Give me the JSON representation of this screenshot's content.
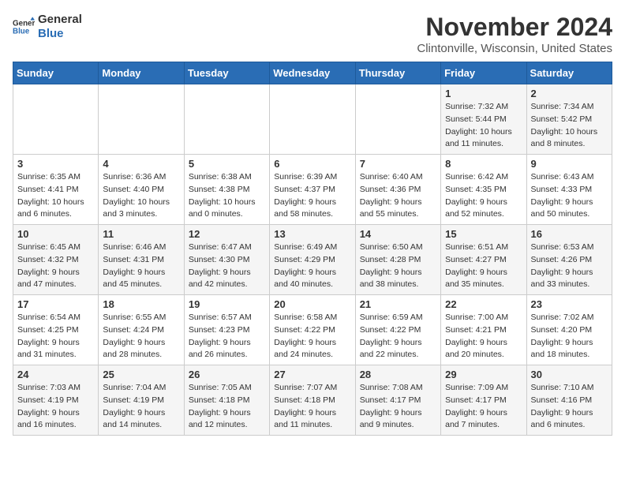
{
  "header": {
    "logo_line1": "General",
    "logo_line2": "Blue",
    "month_title": "November 2024",
    "subtitle": "Clintonville, Wisconsin, United States"
  },
  "days_of_week": [
    "Sunday",
    "Monday",
    "Tuesday",
    "Wednesday",
    "Thursday",
    "Friday",
    "Saturday"
  ],
  "weeks": [
    [
      {
        "day": "",
        "info": ""
      },
      {
        "day": "",
        "info": ""
      },
      {
        "day": "",
        "info": ""
      },
      {
        "day": "",
        "info": ""
      },
      {
        "day": "",
        "info": ""
      },
      {
        "day": "1",
        "info": "Sunrise: 7:32 AM\nSunset: 5:44 PM\nDaylight: 10 hours and 11 minutes."
      },
      {
        "day": "2",
        "info": "Sunrise: 7:34 AM\nSunset: 5:42 PM\nDaylight: 10 hours and 8 minutes."
      }
    ],
    [
      {
        "day": "3",
        "info": "Sunrise: 6:35 AM\nSunset: 4:41 PM\nDaylight: 10 hours and 6 minutes."
      },
      {
        "day": "4",
        "info": "Sunrise: 6:36 AM\nSunset: 4:40 PM\nDaylight: 10 hours and 3 minutes."
      },
      {
        "day": "5",
        "info": "Sunrise: 6:38 AM\nSunset: 4:38 PM\nDaylight: 10 hours and 0 minutes."
      },
      {
        "day": "6",
        "info": "Sunrise: 6:39 AM\nSunset: 4:37 PM\nDaylight: 9 hours and 58 minutes."
      },
      {
        "day": "7",
        "info": "Sunrise: 6:40 AM\nSunset: 4:36 PM\nDaylight: 9 hours and 55 minutes."
      },
      {
        "day": "8",
        "info": "Sunrise: 6:42 AM\nSunset: 4:35 PM\nDaylight: 9 hours and 52 minutes."
      },
      {
        "day": "9",
        "info": "Sunrise: 6:43 AM\nSunset: 4:33 PM\nDaylight: 9 hours and 50 minutes."
      }
    ],
    [
      {
        "day": "10",
        "info": "Sunrise: 6:45 AM\nSunset: 4:32 PM\nDaylight: 9 hours and 47 minutes."
      },
      {
        "day": "11",
        "info": "Sunrise: 6:46 AM\nSunset: 4:31 PM\nDaylight: 9 hours and 45 minutes."
      },
      {
        "day": "12",
        "info": "Sunrise: 6:47 AM\nSunset: 4:30 PM\nDaylight: 9 hours and 42 minutes."
      },
      {
        "day": "13",
        "info": "Sunrise: 6:49 AM\nSunset: 4:29 PM\nDaylight: 9 hours and 40 minutes."
      },
      {
        "day": "14",
        "info": "Sunrise: 6:50 AM\nSunset: 4:28 PM\nDaylight: 9 hours and 38 minutes."
      },
      {
        "day": "15",
        "info": "Sunrise: 6:51 AM\nSunset: 4:27 PM\nDaylight: 9 hours and 35 minutes."
      },
      {
        "day": "16",
        "info": "Sunrise: 6:53 AM\nSunset: 4:26 PM\nDaylight: 9 hours and 33 minutes."
      }
    ],
    [
      {
        "day": "17",
        "info": "Sunrise: 6:54 AM\nSunset: 4:25 PM\nDaylight: 9 hours and 31 minutes."
      },
      {
        "day": "18",
        "info": "Sunrise: 6:55 AM\nSunset: 4:24 PM\nDaylight: 9 hours and 28 minutes."
      },
      {
        "day": "19",
        "info": "Sunrise: 6:57 AM\nSunset: 4:23 PM\nDaylight: 9 hours and 26 minutes."
      },
      {
        "day": "20",
        "info": "Sunrise: 6:58 AM\nSunset: 4:22 PM\nDaylight: 9 hours and 24 minutes."
      },
      {
        "day": "21",
        "info": "Sunrise: 6:59 AM\nSunset: 4:22 PM\nDaylight: 9 hours and 22 minutes."
      },
      {
        "day": "22",
        "info": "Sunrise: 7:00 AM\nSunset: 4:21 PM\nDaylight: 9 hours and 20 minutes."
      },
      {
        "day": "23",
        "info": "Sunrise: 7:02 AM\nSunset: 4:20 PM\nDaylight: 9 hours and 18 minutes."
      }
    ],
    [
      {
        "day": "24",
        "info": "Sunrise: 7:03 AM\nSunset: 4:19 PM\nDaylight: 9 hours and 16 minutes."
      },
      {
        "day": "25",
        "info": "Sunrise: 7:04 AM\nSunset: 4:19 PM\nDaylight: 9 hours and 14 minutes."
      },
      {
        "day": "26",
        "info": "Sunrise: 7:05 AM\nSunset: 4:18 PM\nDaylight: 9 hours and 12 minutes."
      },
      {
        "day": "27",
        "info": "Sunrise: 7:07 AM\nSunset: 4:18 PM\nDaylight: 9 hours and 11 minutes."
      },
      {
        "day": "28",
        "info": "Sunrise: 7:08 AM\nSunset: 4:17 PM\nDaylight: 9 hours and 9 minutes."
      },
      {
        "day": "29",
        "info": "Sunrise: 7:09 AM\nSunset: 4:17 PM\nDaylight: 9 hours and 7 minutes."
      },
      {
        "day": "30",
        "info": "Sunrise: 7:10 AM\nSunset: 4:16 PM\nDaylight: 9 hours and 6 minutes."
      }
    ]
  ]
}
